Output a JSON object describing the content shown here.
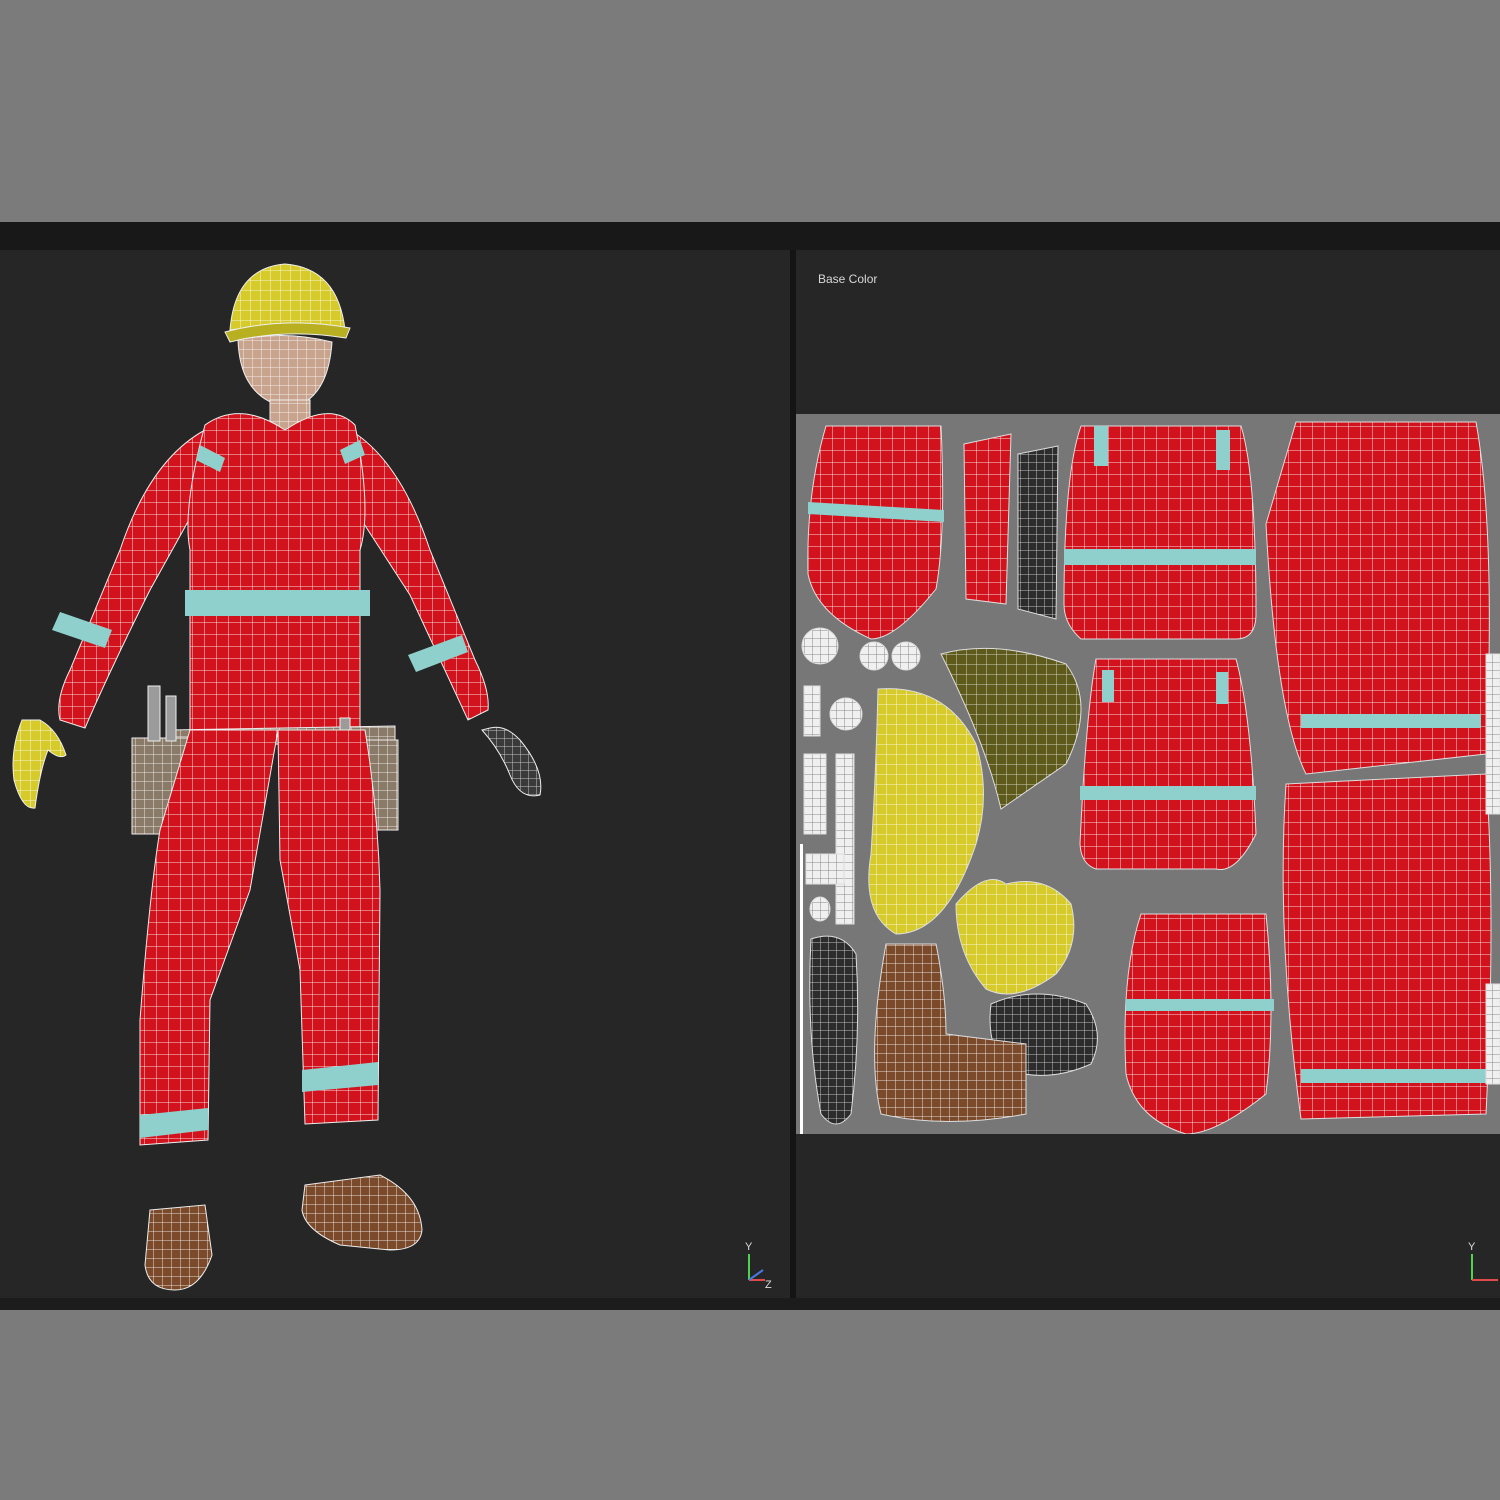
{
  "uv_editor": {
    "channel_label": "Base Color"
  },
  "axis": {
    "y": "Y",
    "z": "Z"
  },
  "colors": {
    "suit_red": "#d2121c",
    "reflective_stripe": "#8fd0cc",
    "helmet_yellow": "#d6cb2a",
    "boot_brown": "#7a4a2a",
    "uv_background": "#777777",
    "viewport_background": "#262626",
    "wire": "#ffffff"
  },
  "icons": [
    "axis-gizmo-icon"
  ]
}
